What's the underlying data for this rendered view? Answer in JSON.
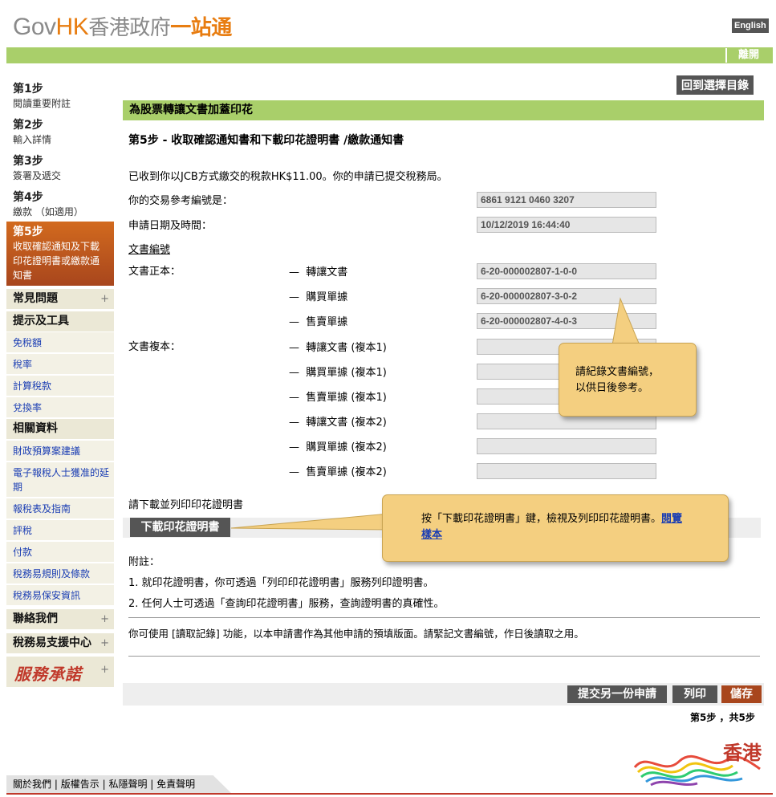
{
  "header": {
    "logo_gov": "Gov",
    "logo_hk": "HK",
    "logo_zh_a": "香港政府",
    "logo_zh_b": "一站通",
    "lang_label": "English",
    "logout_label": "離開"
  },
  "sidebar": {
    "steps": [
      {
        "title": "第1步",
        "desc": "閱讀重要附註"
      },
      {
        "title": "第2步",
        "desc": "輸入詳情"
      },
      {
        "title": "第3步",
        "desc": "簽署及遞交"
      },
      {
        "title": "第4步",
        "desc": "繳款 （如適用）"
      }
    ],
    "current_step": {
      "title": "第5步",
      "desc": "收取確認通知及下載印花證明書或繳款通知書"
    },
    "sections": {
      "faq": "常見問題",
      "tips": "提示及工具",
      "tips_links": [
        "免稅額",
        "稅率",
        "計算稅款",
        "兌換率"
      ],
      "related": "相關資料",
      "related_links": [
        "財政預算案建議",
        "電子報稅人士獲准的延期",
        "報稅表及指南",
        "評稅",
        "付款",
        "稅務易規則及條款",
        "稅務易保安資訊"
      ],
      "contact": "聯絡我們",
      "support": "稅務易支援中心",
      "service_logo": "服務承諾"
    },
    "plus_icon": "+"
  },
  "main": {
    "back_label": "回到選擇目錄",
    "section_title": "為股票轉讓文書加蓋印花",
    "step_title": "第5步 - 收取確認通知書和下載印花證明書 /繳款通知書",
    "payment_msg": "已收到你以JCB方式繳交的稅款HK$11.00。你的申請已提交稅務局。",
    "ref_label": "你的交易參考編號是：",
    "ref_value": "6861 9121 0460 3207",
    "date_label": "申請日期及時間：",
    "date_value": "10/12/2019 16:44:40",
    "doc_no_label": "文書編號",
    "original_label": "文書正本：",
    "copy_label": "文書複本：",
    "dash": "—",
    "original_docs": [
      {
        "label": "轉讓文書",
        "value": "6-20-000002807-1-0-0"
      },
      {
        "label": "購買單據",
        "value": "6-20-000002807-3-0-2"
      },
      {
        "label": "售賣單據",
        "value": "6-20-000002807-4-0-3"
      }
    ],
    "copy_docs": [
      {
        "label": "轉讓文書 (複本1)",
        "value": ""
      },
      {
        "label": "購買單據 (複本1)",
        "value": ""
      },
      {
        "label": "售賣單據 (複本1)",
        "value": ""
      },
      {
        "label": "轉讓文書 (複本2)",
        "value": ""
      },
      {
        "label": "購買單據 (複本2)",
        "value": ""
      },
      {
        "label": "售賣單據 (複本2)",
        "value": ""
      }
    ],
    "tip1_line1": "請紀錄文書編號，",
    "tip1_line2": "以供日後參考。",
    "download_prompt": "請下載並列印印花證明書",
    "download_label": "下載印花證明書",
    "tip2_text": "按「下載印花證明書」鍵，檢視及列印印花證明書。",
    "tip2_link": "閱覽樣本",
    "notes_title": "附註：",
    "notes": [
      "1. 就印花證明書，你可透過「列印印花證明書」服務列印證明書。",
      "2. 任何人士可透過「查詢印花證明書」服務，查詢證明書的真確性。"
    ],
    "reuse_note": "你可使用 [讀取記錄] 功能，以本申請書作為其他申請的預填版面。請緊記文書編號，作日後讀取之用。",
    "submit_another_label": "提交另一份申請",
    "print_label": "列印",
    "save_label": "儲存",
    "page_count": "第5步 ，共5步"
  },
  "footer": {
    "links": [
      "關於我們",
      "版權告示",
      "私隱聲明",
      "免責聲明"
    ],
    "separator": "|",
    "brand_text": "香港"
  }
}
